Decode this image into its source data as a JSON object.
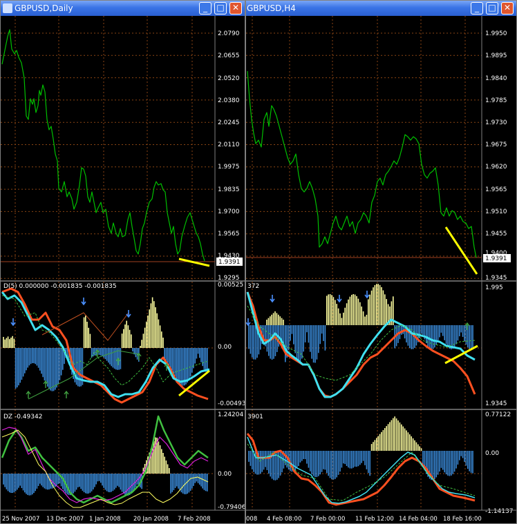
{
  "left_window": {
    "title": "GBPUSD,Daily",
    "price_axis": [
      "2.0790",
      "2.0655",
      "2.0520",
      "2.0380",
      "2.0245",
      "2.0110",
      "1.9975",
      "1.9835",
      "1.9700",
      "1.9565",
      "1.9430",
      "1.9295"
    ],
    "current_price": "1.9391",
    "ind1_label": "D(5) 0.000000 -0.001835 -0.001835",
    "ind1_axis": [
      "0.00525",
      "0.00",
      "-0.00493"
    ],
    "ind2_label": "DZ -0.49342",
    "ind2_axis": [
      "1.24204",
      "0.00",
      "-0.79406"
    ],
    "date_axis": [
      "25 Nov 2007",
      "13 Dec 2007",
      "1 Jan 2008",
      "20 Jan 2008",
      "7 Feb 2008"
    ]
  },
  "right_window": {
    "title": "GBPUSD,H4",
    "price_axis": [
      "1.9950",
      "1.9895",
      "1.9840",
      "1.9785",
      "1.9730",
      "1.9675",
      "1.9620",
      "1.9565",
      "1.9510",
      "1.9455",
      "1.9400",
      "1.9345"
    ],
    "current_price": "1.9391",
    "ind1_label": "372",
    "ind1_axis": [
      "1.995",
      "1.9345"
    ],
    "ind2_label": "3901",
    "ind2_axis": [
      "0.77122",
      "0.00",
      "-1.14137"
    ],
    "date_axis": [
      "008",
      "4 Feb 08:00",
      "7 Feb 00:00",
      "11 Feb 12:00",
      "14 Feb 04:00",
      "18 Feb 16:00"
    ]
  },
  "window_buttons": {
    "minimize": "_",
    "maximize": "□",
    "close": "✕"
  },
  "colors": {
    "background": "#000000",
    "grid": "#8b4513",
    "price_line": "#00c000",
    "trend_line": "#ffff00",
    "histogram_pos": "#ffffa0",
    "histogram_neg": "#3a8ad8",
    "cyan_line": "#40e0f0",
    "orange_line": "#ff5020",
    "green_line": "#40c040",
    "magenta_line": "#e020e0",
    "yellow_line": "#ffff60",
    "arrow_blue": "#4a90ff",
    "arrow_green": "#40a040"
  }
}
